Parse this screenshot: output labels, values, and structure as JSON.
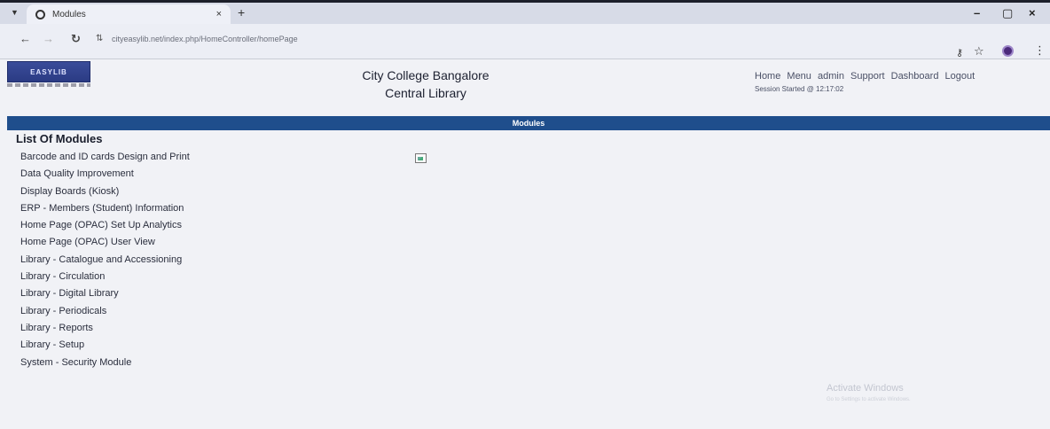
{
  "browser": {
    "tab_title": "Modules",
    "tab_close": "×",
    "new_tab": "+",
    "url": "cityeasylib.net/index.php/HomeController/homePage",
    "controls": {
      "minimize": "–",
      "maximize": "▢",
      "close": "×"
    },
    "icons": [
      "back-arrow-icon",
      "forward-arrow-icon",
      "reload-icon",
      "site-info-icon",
      "key-icon",
      "star-icon",
      "profile-icon",
      "kebab-menu-icon"
    ]
  },
  "header": {
    "logo_text": "EASYLIB",
    "college_name": "City College Bangalore",
    "library_name": "Central Library",
    "links": [
      "Home",
      "Menu",
      "admin",
      "Support",
      "Dashboard",
      "Logout"
    ],
    "session": "Session Started @ 12:17:02"
  },
  "modules_bar": {
    "title": "Modules"
  },
  "list": {
    "heading": "List Of Modules",
    "items": [
      "Barcode and ID cards Design and Print",
      "Data Quality Improvement",
      "Display Boards (Kiosk)",
      "ERP - Members (Student) Information",
      "Home Page (OPAC) Set Up Analytics",
      "Home Page (OPAC) User View",
      "Library - Catalogue and Accessioning",
      "Library - Circulation",
      "Library - Digital Library",
      "Library - Periodicals",
      "Library - Reports",
      "Library - Setup",
      "System - Security Module"
    ]
  },
  "watermark": {
    "title": "Activate Windows",
    "subtitle": "Go to Settings to activate Windows."
  }
}
